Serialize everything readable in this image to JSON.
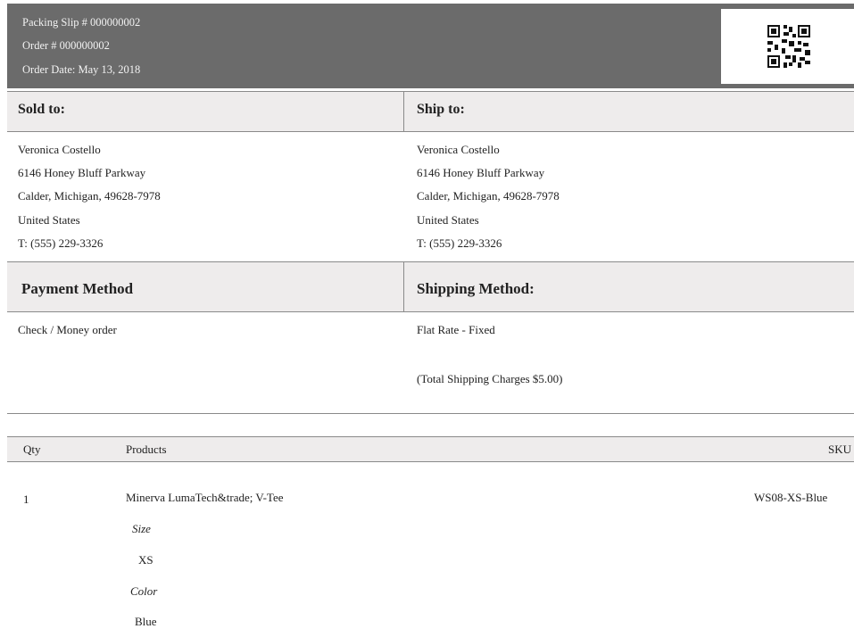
{
  "header": {
    "packing_slip": "Packing Slip # 000000002",
    "order": "Order # 000000002",
    "order_date": "Order Date: May 13, 2018"
  },
  "sold_to": {
    "title": "Sold to:",
    "lines": [
      "Veronica Costello",
      "6146 Honey Bluff Parkway",
      "Calder, Michigan, 49628-7978",
      "United States",
      "T: (555) 229-3326"
    ]
  },
  "ship_to": {
    "title": "Ship to:",
    "lines": [
      "Veronica Costello",
      "6146 Honey Bluff Parkway",
      "Calder, Michigan, 49628-7978",
      "United States",
      "T: (555) 229-3326"
    ]
  },
  "payment": {
    "title": "Payment Method",
    "value": "Check / Money order"
  },
  "shipping": {
    "title": "Shipping Method:",
    "value": "Flat Rate - Fixed",
    "charges": "(Total Shipping Charges $5.00)"
  },
  "items": {
    "headers": {
      "qty": "Qty",
      "products": "Products",
      "sku": "SKU"
    },
    "rows": [
      {
        "qty": "1",
        "product": "Minerva LumaTech&trade; V-Tee",
        "sku": "WS08-XS-Blue",
        "options": [
          {
            "label": "Size",
            "value": "XS"
          },
          {
            "label": "Color",
            "value": "Blue"
          }
        ]
      }
    ]
  },
  "colors": {
    "header_bg": "#6b6b6b",
    "band_bg": "#eeecec",
    "rule": "#8a8a8a"
  },
  "icons": {
    "qr": "qr-code-icon"
  }
}
